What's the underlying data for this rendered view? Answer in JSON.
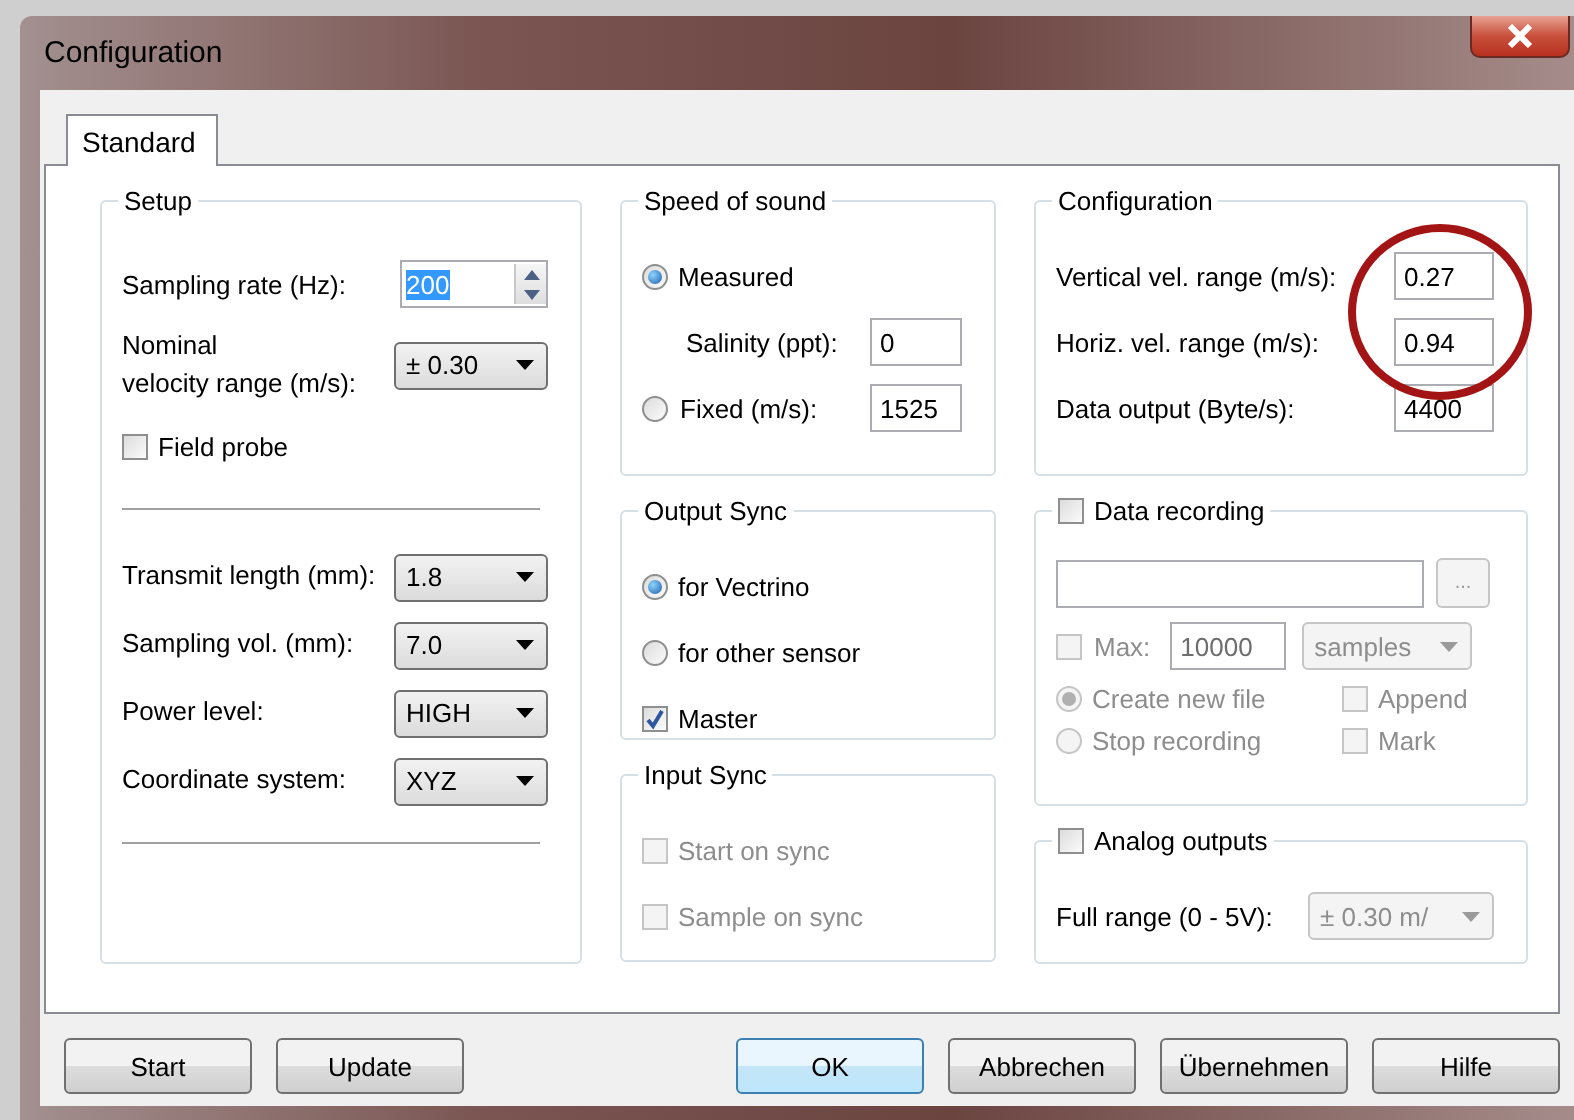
{
  "window": {
    "title": "Configuration"
  },
  "tabs": [
    {
      "label": "Standard",
      "selected": true
    }
  ],
  "setup": {
    "title": "Setup",
    "sections": [
      [
        {
          "kind": "spin",
          "label": "Sampling rate (Hz):",
          "value": "200",
          "text_selected": true
        },
        {
          "kind": "dropdown",
          "label": "Nominal\nvelocity range (m/s):",
          "value": "± 0.30"
        },
        {
          "kind": "checkbox",
          "label": "Field probe",
          "checked": false
        }
      ],
      [
        {
          "kind": "dropdown",
          "label": "Transmit length (mm):",
          "value": "1.8"
        },
        {
          "kind": "dropdown",
          "label": "Sampling vol. (mm):",
          "value": "7.0"
        },
        {
          "kind": "dropdown",
          "label": "Power level:",
          "value": "HIGH"
        },
        {
          "kind": "dropdown",
          "label": "Coordinate system:",
          "value": "XYZ"
        }
      ]
    ]
  },
  "speed_of_sound": {
    "title": "Speed of sound",
    "items": [
      {
        "kind": "radio",
        "label": "Measured",
        "selected": true
      },
      {
        "kind": "field",
        "label": "Salinity (ppt):",
        "value": "0"
      },
      {
        "kind": "radio_field",
        "label": "Fixed (m/s):",
        "value": "1525",
        "selected": false
      }
    ]
  },
  "output_sync": {
    "title": "Output Sync",
    "items": [
      {
        "kind": "radio",
        "label": "for Vectrino",
        "selected": true
      },
      {
        "kind": "radio",
        "label": "for other sensor",
        "selected": false
      },
      {
        "kind": "checkbox",
        "label": "Master",
        "checked": true
      }
    ]
  },
  "input_sync": {
    "title": "Input Sync",
    "items": [
      {
        "kind": "checkbox",
        "label": "Start on sync",
        "checked": false,
        "disabled": true
      },
      {
        "kind": "checkbox",
        "label": "Sample on sync",
        "checked": false,
        "disabled": true
      }
    ]
  },
  "configuration": {
    "title": "Configuration",
    "fields": [
      {
        "label": "Vertical vel. range (m/s):",
        "value": "0.27"
      },
      {
        "label": "Horiz. vel. range (m/s):",
        "value": "0.94"
      },
      {
        "label": "Data output (Byte/s):",
        "value": "4400"
      }
    ]
  },
  "data_recording": {
    "label": "Data recording",
    "checked": false,
    "disabled": true,
    "browse_label": "...",
    "max": {
      "label": "Max:",
      "checked": false,
      "value": "10000",
      "unit": "samples"
    },
    "modes": [
      {
        "label": "Create new file",
        "selected": true
      },
      {
        "label": "Stop recording",
        "selected": false
      }
    ],
    "options": [
      {
        "label": "Append",
        "checked": false
      },
      {
        "label": "Mark",
        "checked": false
      }
    ]
  },
  "analog_outputs": {
    "label": "Analog outputs",
    "checked": false,
    "disabled": true,
    "range_label": "Full range (0 - 5V):",
    "range_value": "± 0.30 m/"
  },
  "left_buttons": [
    {
      "label": "Start",
      "default": false
    },
    {
      "label": "Update",
      "default": false
    }
  ],
  "right_buttons": [
    {
      "label": "OK",
      "default": true
    },
    {
      "label": "Abbrechen",
      "default": false
    },
    {
      "label": "Übernehmen",
      "default": false
    },
    {
      "label": "Hilfe",
      "default": false
    }
  ]
}
